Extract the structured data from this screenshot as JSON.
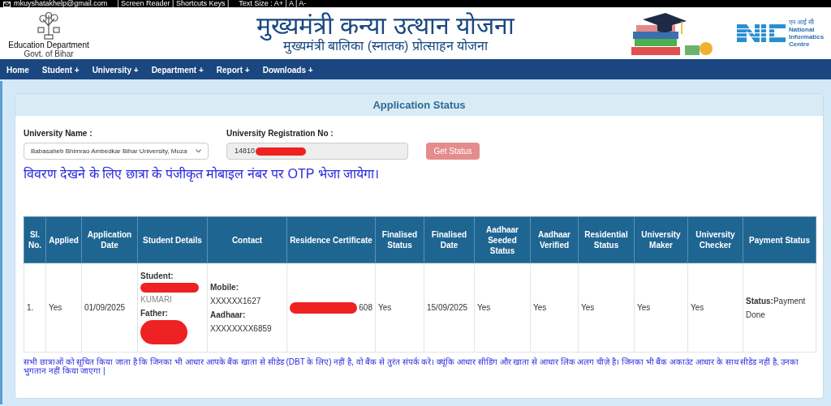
{
  "top_bar": {
    "email": "mkuyshatakhelp@gmail.com",
    "links": "| Screen Reader | Shortcuts Keys |",
    "text_size": "Text Size : A+ | A  |  A-"
  },
  "header": {
    "dept_line1": "Education Department",
    "dept_line2": "Govt. of Bihar",
    "title": "मुख्यमंत्री कन्या उत्थान योजना",
    "subtitle": "मुख्यमंत्री बालिका (स्नातक) प्रोत्साहन योजना",
    "nic_hindi": "एन आई सी",
    "nic_name": "National Informatics Centre"
  },
  "nav": [
    {
      "label": "Home"
    },
    {
      "label": "Student +"
    },
    {
      "label": "University +"
    },
    {
      "label": "Department +"
    },
    {
      "label": "Report +"
    },
    {
      "label": "Downloads +"
    }
  ],
  "panel": {
    "title": "Application Status",
    "form": {
      "university_label": "University Name :",
      "university_value": "Babasaheb Bhimrao Ambedkar Bihar University, Muza",
      "registration_label": "University Registration No :",
      "registration_value": "14810",
      "registration_redacted": true,
      "button": "Get Status"
    },
    "otp_notice": "विवरण देखने के लिए छात्रा के पंजीकृत मोबाइल नंबर पर OTP भेजा जायेगा।",
    "table": {
      "columns": [
        "Sl. No.",
        "Applied",
        "Application Date",
        "Student Details",
        "Contact",
        "Residence Certificate",
        "Finalised Status",
        "Finalised Date",
        "Aadhaar Seeded Status",
        "Aadhaar Verified",
        "Residential Status",
        "University Maker",
        "University Checker",
        "Payment Status"
      ],
      "rows": [
        {
          "sl": "1.",
          "applied": "Yes",
          "application_date": "01/09/2025",
          "student_label": "Student:",
          "student_name": "KUMARI",
          "father_label": "Father:",
          "mobile_label": "Mobile:",
          "mobile": "XXXXXX1627",
          "aadhaar_label": "Aadhaar:",
          "aadhaar": "XXXXXXXX6859",
          "residence_certificate": "608",
          "finalised_status": "Yes",
          "finalised_date": "15/09/2025",
          "aadhaar_seeded": "Yes",
          "aadhaar_verified": "Yes",
          "residential_status": "Yes",
          "university_maker": "Yes",
          "university_checker": "Yes",
          "payment_label": "Status:",
          "payment_value": "Payment Done"
        }
      ]
    },
    "footer_notice": "सभी छात्राओं को सूचित किया जाता है कि जिनका भी आधार आपके बैंक खाता से सीडेड (DBT के लिए) नहीं है, वो बैंक से तुरंत संपर्क करे। क्यूंकि आधार सीडिंग और खाता से आधार लिंक अलग चीज़े है। जिनका भी बैंक अकाउंट आधार के साथ सीडेड नहीं है, उनका भुगतान नहीं किया जाएगा |"
  }
}
